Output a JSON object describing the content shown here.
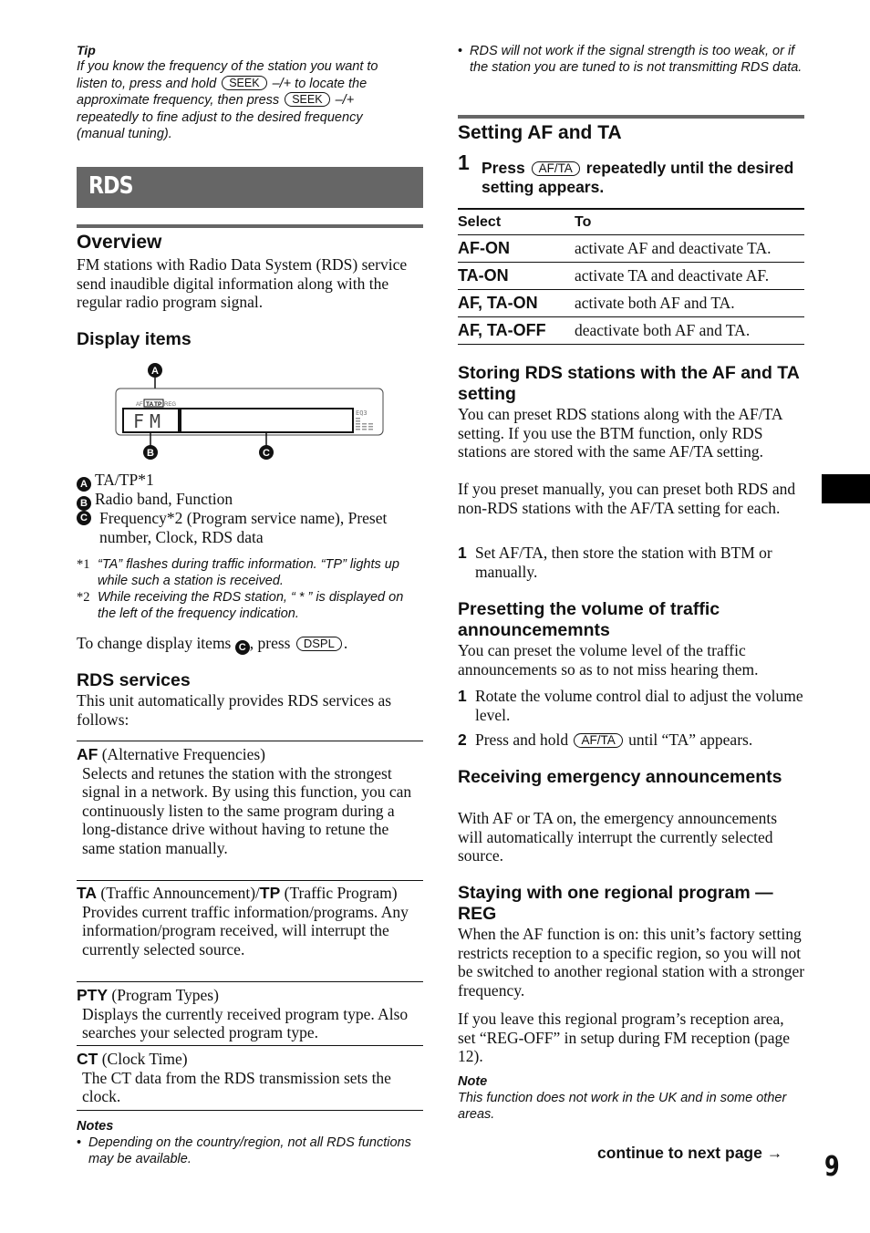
{
  "tip": {
    "title": "Tip",
    "line1": "If you know the frequency of the station you want to",
    "line2_pre": "listen to, press and hold",
    "seek_key": "SEEK",
    "line2_post": "–/+ to locate the",
    "line3_pre": "approximate frequency, then press",
    "line3_post": "–/+",
    "line4": "repeatedly to fine adjust to the desired frequency",
    "line5": "(manual tuning)."
  },
  "rds_banner": "RDS",
  "overview": {
    "heading": "Overview",
    "body": "FM stations with Radio Data System (RDS) service send inaudible digital information along with the regular radio program signal."
  },
  "display_items": {
    "heading": "Display items",
    "diagram": {
      "callouts": [
        "A",
        "B",
        "C"
      ],
      "indicators": [
        "AF",
        "TA",
        "TP",
        "REG"
      ],
      "band_text": "FM",
      "eq_text": "EQ3"
    },
    "legend": [
      {
        "marker": "A",
        "text": "TA/TP*1"
      },
      {
        "marker": "B",
        "text": "Radio band, Function"
      },
      {
        "marker": "C",
        "text": "Frequency*2 (Program service name), Preset number, Clock, RDS data"
      }
    ],
    "footnotes": [
      {
        "mark": "*1",
        "text": "“TA” flashes during traffic information. “TP” lights up while such a station is received."
      },
      {
        "mark": "*2",
        "text": "While receiving the RDS station, “ * ” is displayed on the left of the frequency indication."
      }
    ],
    "change_pre": "To change display items",
    "change_marker": "C",
    "change_mid": ", press",
    "dspl_key": "DSPL",
    "change_post": "."
  },
  "rds_services": {
    "heading": "RDS services",
    "intro": "This unit automatically provides RDS services as follows:",
    "items": [
      {
        "abbr": "AF",
        "name": " (Alternative Frequencies)",
        "desc": "Selects and retunes the station with the strongest signal in a network. By using this function, you can continuously listen to the same program during a long-distance drive without having to retune the same station manually."
      },
      {
        "abbr": "TA",
        "name": " (Traffic Announcement)/",
        "abbr2": "TP",
        "name2": " (Traffic Program)",
        "desc": "Provides current traffic information/programs. Any information/program received, will interrupt the currently selected source."
      },
      {
        "abbr": "PTY",
        "name": " (Program Types)",
        "desc": "Displays the currently received program type. Also searches your selected program type."
      },
      {
        "abbr": "CT",
        "name": " (Clock Time)",
        "desc": "The CT data from the RDS transmission sets the clock."
      }
    ]
  },
  "notes": {
    "heading": "Notes",
    "items": [
      "Depending on the country/region, not all RDS functions may be available.",
      "RDS will not work if the signal strength is too weak, or if the station you are tuned to is not transmitting RDS data."
    ]
  },
  "setting_af_ta": {
    "heading": "Setting AF and TA",
    "step_num": "1",
    "step_pre": "Press",
    "key": "AF/TA",
    "step_post": "repeatedly until the desired setting appears.",
    "table": {
      "headers": [
        "Select",
        "To"
      ],
      "rows": [
        [
          "AF-ON",
          "activate AF and deactivate TA."
        ],
        [
          "TA-ON",
          "activate TA and deactivate AF."
        ],
        [
          "AF, TA-ON",
          "activate both AF and TA."
        ],
        [
          "AF, TA-OFF",
          "deactivate both AF and TA."
        ]
      ]
    }
  },
  "storing": {
    "heading": "Storing RDS stations with the AF and TA setting",
    "body1": "You can preset RDS stations along with the AF/TA setting. If you use the BTM function, only RDS stations are stored with the same AF/TA setting.",
    "body2": "If you preset manually, you can preset both RDS and non-RDS stations with the AF/TA setting for each.",
    "steps": [
      {
        "num": "1",
        "text": "Set AF/TA, then store the station with BTM or manually."
      }
    ]
  },
  "presetting": {
    "heading": "Presetting the volume of traffic announcememnts",
    "body": "You can preset the volume level of the traffic announcements so as to not miss hearing them.",
    "step1_num": "1",
    "step1": "Rotate the volume control dial to adjust the volume level.",
    "step2_num": "2",
    "step2_pre": "Press and hold",
    "step2_key": "AF/TA",
    "step2_post": "until “TA” appears."
  },
  "emergency": {
    "heading": "Receiving emergency announcements",
    "body": "With AF or TA on, the emergency announcements will automatically interrupt the currently selected source."
  },
  "regional": {
    "heading": "Staying with one regional program — REG",
    "body1": "When the AF function is on: this unit’s factory setting restricts reception to a specific region, so you will not be switched to another regional station with a stronger frequency.",
    "body2": "If you leave this regional program’s reception area, set “REG-OFF” in setup during FM reception (page 12).",
    "note_heading": "Note",
    "note": "This function does not work in the UK and in some other areas."
  },
  "footer": {
    "continue": "continue to next page →",
    "page_number": "9"
  }
}
